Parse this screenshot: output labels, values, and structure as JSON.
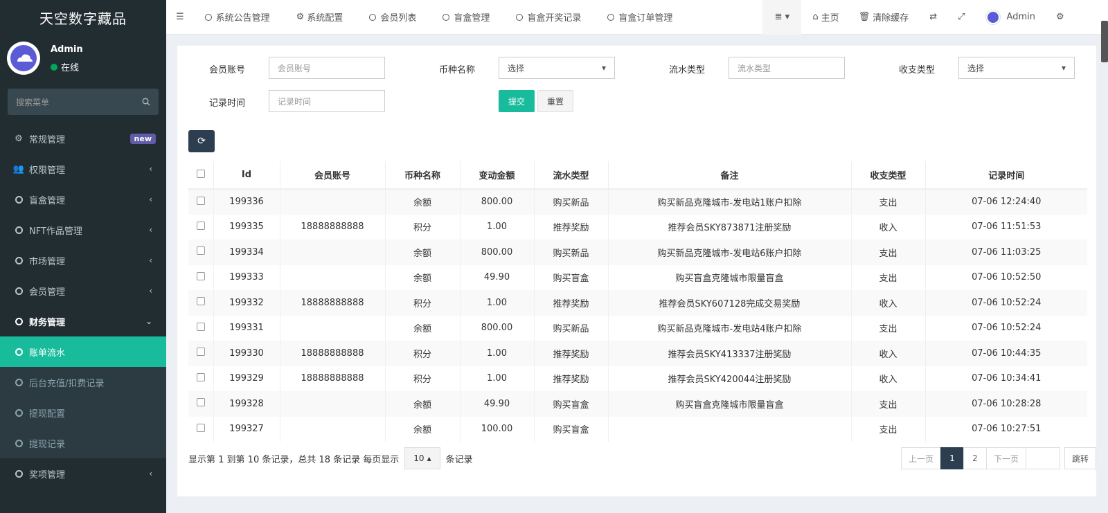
{
  "brand": "天空数字藏品",
  "user": {
    "name": "Admin",
    "status": "在线"
  },
  "sidebar": {
    "search_placeholder": "搜索菜单",
    "items": [
      {
        "label": "常规管理",
        "badge": "new"
      },
      {
        "label": "权限管理"
      },
      {
        "label": "盲盒管理"
      },
      {
        "label": "NFT作品管理"
      },
      {
        "label": "市场管理"
      },
      {
        "label": "会员管理"
      },
      {
        "label": "财务管理"
      },
      {
        "label": "账单流水"
      },
      {
        "label": "后台充值/扣费记录"
      },
      {
        "label": "提现配置"
      },
      {
        "label": "提现记录"
      },
      {
        "label": "奖项管理"
      }
    ]
  },
  "topnav": {
    "tabs": [
      "系统公告管理",
      "系统配置",
      "会员列表",
      "盲盒管理",
      "盲盒开奖记录",
      "盲盒订单管理"
    ],
    "home": "主页",
    "clear_cache": "清除缓存",
    "admin": "Admin"
  },
  "filters": {
    "account_label": "会员账号",
    "account_placeholder": "会员账号",
    "currency_label": "币种名称",
    "currency_value": "选择",
    "flow_label": "流水类型",
    "flow_placeholder": "流水类型",
    "io_label": "收支类型",
    "io_value": "选择",
    "time_label": "记录时间",
    "time_placeholder": "记录时间",
    "submit": "提交",
    "reset": "重置"
  },
  "table": {
    "headers": [
      "Id",
      "会员账号",
      "币种名称",
      "变动金额",
      "流水类型",
      "备注",
      "收支类型",
      "记录时间"
    ],
    "rows": [
      [
        "199336",
        "",
        "余额",
        "800.00",
        "购买新品",
        "购买新品克隆城市-发电站1账户扣除",
        "支出",
        "07-06 12:24:40"
      ],
      [
        "199335",
        "18888888888",
        "积分",
        "1.00",
        "推荐奖励",
        "推荐会员SKY873871注册奖励",
        "收入",
        "07-06 11:51:53"
      ],
      [
        "199334",
        "",
        "余额",
        "800.00",
        "购买新品",
        "购买新品克隆城市-发电站6账户扣除",
        "支出",
        "07-06 11:03:25"
      ],
      [
        "199333",
        "",
        "余额",
        "49.90",
        "购买盲盒",
        "购买盲盒克隆城市限量盲盒",
        "支出",
        "07-06 10:52:50"
      ],
      [
        "199332",
        "18888888888",
        "积分",
        "1.00",
        "推荐奖励",
        "推荐会员SKY607128完成交易奖励",
        "收入",
        "07-06 10:52:24"
      ],
      [
        "199331",
        "",
        "余额",
        "800.00",
        "购买新品",
        "购买新品克隆城市-发电站4账户扣除",
        "支出",
        "07-06 10:52:24"
      ],
      [
        "199330",
        "18888888888",
        "积分",
        "1.00",
        "推荐奖励",
        "推荐会员SKY413337注册奖励",
        "收入",
        "07-06 10:44:35"
      ],
      [
        "199329",
        "18888888888",
        "积分",
        "1.00",
        "推荐奖励",
        "推荐会员SKY420044注册奖励",
        "收入",
        "07-06 10:34:41"
      ],
      [
        "199328",
        "",
        "余额",
        "49.90",
        "购买盲盒",
        "购买盲盒克隆城市限量盲盒",
        "支出",
        "07-06 10:28:28"
      ],
      [
        "199327",
        "",
        "余额",
        "100.00",
        "购买盲盒",
        "",
        "支出",
        "07-06 10:27:51"
      ]
    ]
  },
  "pagination": {
    "info_prefix": "显示第 1 到第 10 条记录，总共 18 条记录 每页显示",
    "page_size": "10",
    "info_suffix": "条记录",
    "prev": "上一页",
    "pages": [
      "1",
      "2"
    ],
    "next": "下一页",
    "jump": "跳转"
  },
  "colors": {
    "sidebar_bg": "#222d32",
    "accent": "#18bc9c",
    "dark_button": "#2c3e50",
    "badge": "#605ca8"
  }
}
